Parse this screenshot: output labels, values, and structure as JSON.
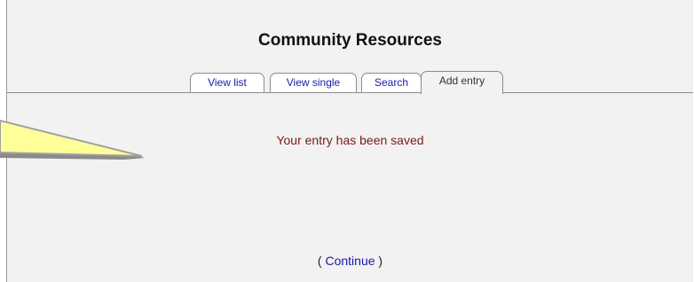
{
  "page": {
    "title": "Community Resources"
  },
  "tabs": [
    {
      "label": "View list"
    },
    {
      "label": "View single"
    },
    {
      "label": "Search"
    },
    {
      "label": "Add entry"
    }
  ],
  "message": "Your entry has been saved",
  "continue": {
    "open": "(",
    "label": "Continue",
    "close": ")"
  },
  "colors": {
    "panel": "#f2f2f2",
    "link": "#1a1aa8",
    "message": "#7a1a1a",
    "callout_fill": "#ffff99"
  }
}
